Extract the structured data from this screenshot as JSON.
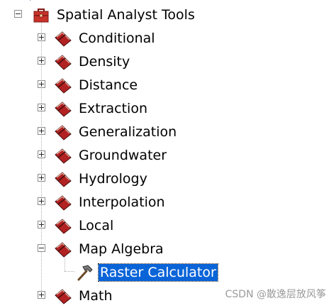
{
  "tree": {
    "root": {
      "label": "Spatial Analyst Tools",
      "icon": "red-toolbox-icon",
      "state": "expanded"
    },
    "toolsets": [
      {
        "label": "Conditional",
        "state": "collapsed"
      },
      {
        "label": "Density",
        "state": "collapsed"
      },
      {
        "label": "Distance",
        "state": "collapsed"
      },
      {
        "label": "Extraction",
        "state": "collapsed"
      },
      {
        "label": "Generalization",
        "state": "collapsed"
      },
      {
        "label": "Groundwater",
        "state": "collapsed"
      },
      {
        "label": "Hydrology",
        "state": "collapsed"
      },
      {
        "label": "Interpolation",
        "state": "collapsed"
      },
      {
        "label": "Local",
        "state": "collapsed"
      },
      {
        "label": "Map Algebra",
        "state": "expanded"
      },
      {
        "label": "Math",
        "state": "collapsed"
      }
    ],
    "tool": {
      "label": "Raster Calculator",
      "icon": "hammer-icon",
      "selected": true
    }
  },
  "watermark": "CSDN @散逸层放风筝",
  "colors": {
    "selection": "#0a64d8",
    "toolbox_red": "#c8322a",
    "toolset_icon": "#b22222"
  }
}
